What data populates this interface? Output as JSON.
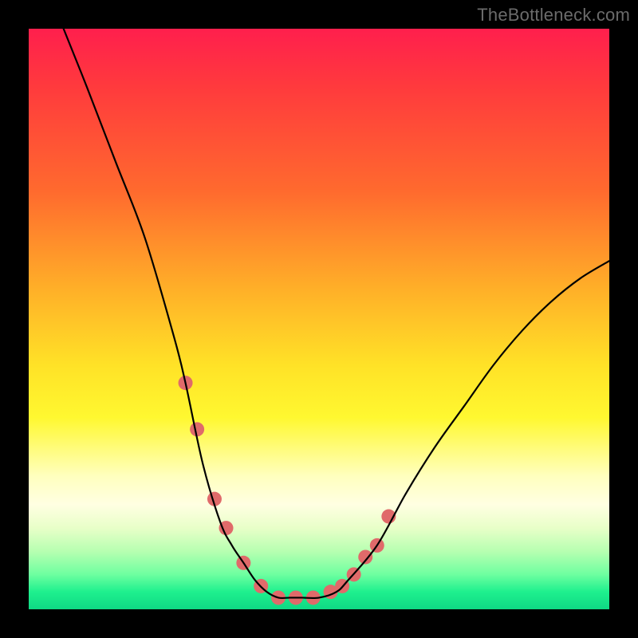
{
  "watermark": {
    "text": "TheBottleneck.com"
  },
  "chart_data": {
    "type": "line",
    "title": "",
    "xlabel": "",
    "ylabel": "",
    "xlim": [
      0,
      100
    ],
    "ylim": [
      0,
      100
    ],
    "series": [
      {
        "name": "bottleneck-curve",
        "x": [
          6,
          10,
          15,
          20,
          25,
          27,
          30,
          33,
          35,
          37,
          39,
          41,
          43,
          45,
          47,
          50,
          53,
          55,
          60,
          65,
          70,
          75,
          80,
          85,
          90,
          95,
          100
        ],
        "y": [
          100,
          90,
          77,
          64,
          47,
          39,
          25,
          15,
          11,
          8,
          5,
          3,
          2,
          2,
          2,
          2,
          3,
          5,
          11,
          20,
          28,
          35,
          42,
          48,
          53,
          57,
          60
        ]
      }
    ],
    "markers": {
      "name": "highlight-points",
      "x": [
        27,
        29,
        32,
        34,
        37,
        40,
        43,
        46,
        49,
        52,
        54,
        56,
        58,
        60,
        62
      ],
      "y": [
        39,
        31,
        19,
        14,
        8,
        4,
        2,
        2,
        2,
        3,
        4,
        6,
        9,
        11,
        16
      ],
      "color": "#e06a6a",
      "radius": 9
    },
    "curve_style": {
      "stroke": "#000000",
      "width": 2.2
    }
  }
}
